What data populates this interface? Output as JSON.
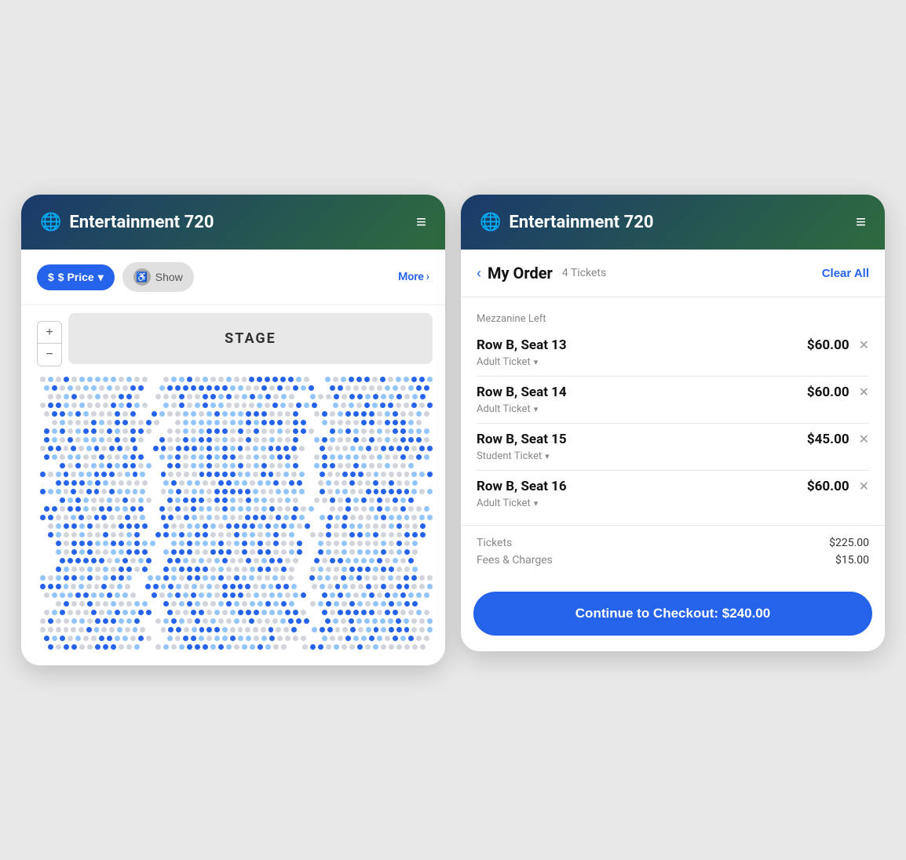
{
  "app": {
    "title": "Entertainment 720",
    "globe_icon": "⊕",
    "hamburger": "≡"
  },
  "left_panel": {
    "filter": {
      "price_label": "$ Price",
      "price_arrow": "▾",
      "accessibility_icon": "♿",
      "show_label": "Show",
      "more_label": "More",
      "more_arrow": "›"
    },
    "stage_label": "STAGE",
    "zoom_plus": "+",
    "zoom_minus": "−"
  },
  "right_panel": {
    "back_icon": "‹",
    "order_title": "My Order",
    "ticket_count": "4 Tickets",
    "clear_all_label": "Clear All",
    "section_label": "Mezzanine Left",
    "tickets": [
      {
        "seat": "Row B, Seat 13",
        "price": "$60.00",
        "type": "Adult Ticket"
      },
      {
        "seat": "Row B, Seat 14",
        "price": "$60.00",
        "type": "Adult Ticket"
      },
      {
        "seat": "Row B, Seat 15",
        "price": "$45.00",
        "type": "Student Ticket"
      },
      {
        "seat": "Row B, Seat 16",
        "price": "$60.00",
        "type": "Adult Ticket"
      }
    ],
    "totals": {
      "tickets_label": "Tickets",
      "tickets_value": "$225.00",
      "fees_label": "Fees & Charges",
      "fees_value": "$15.00"
    },
    "checkout_label": "Continue to Checkout: $240.00"
  }
}
